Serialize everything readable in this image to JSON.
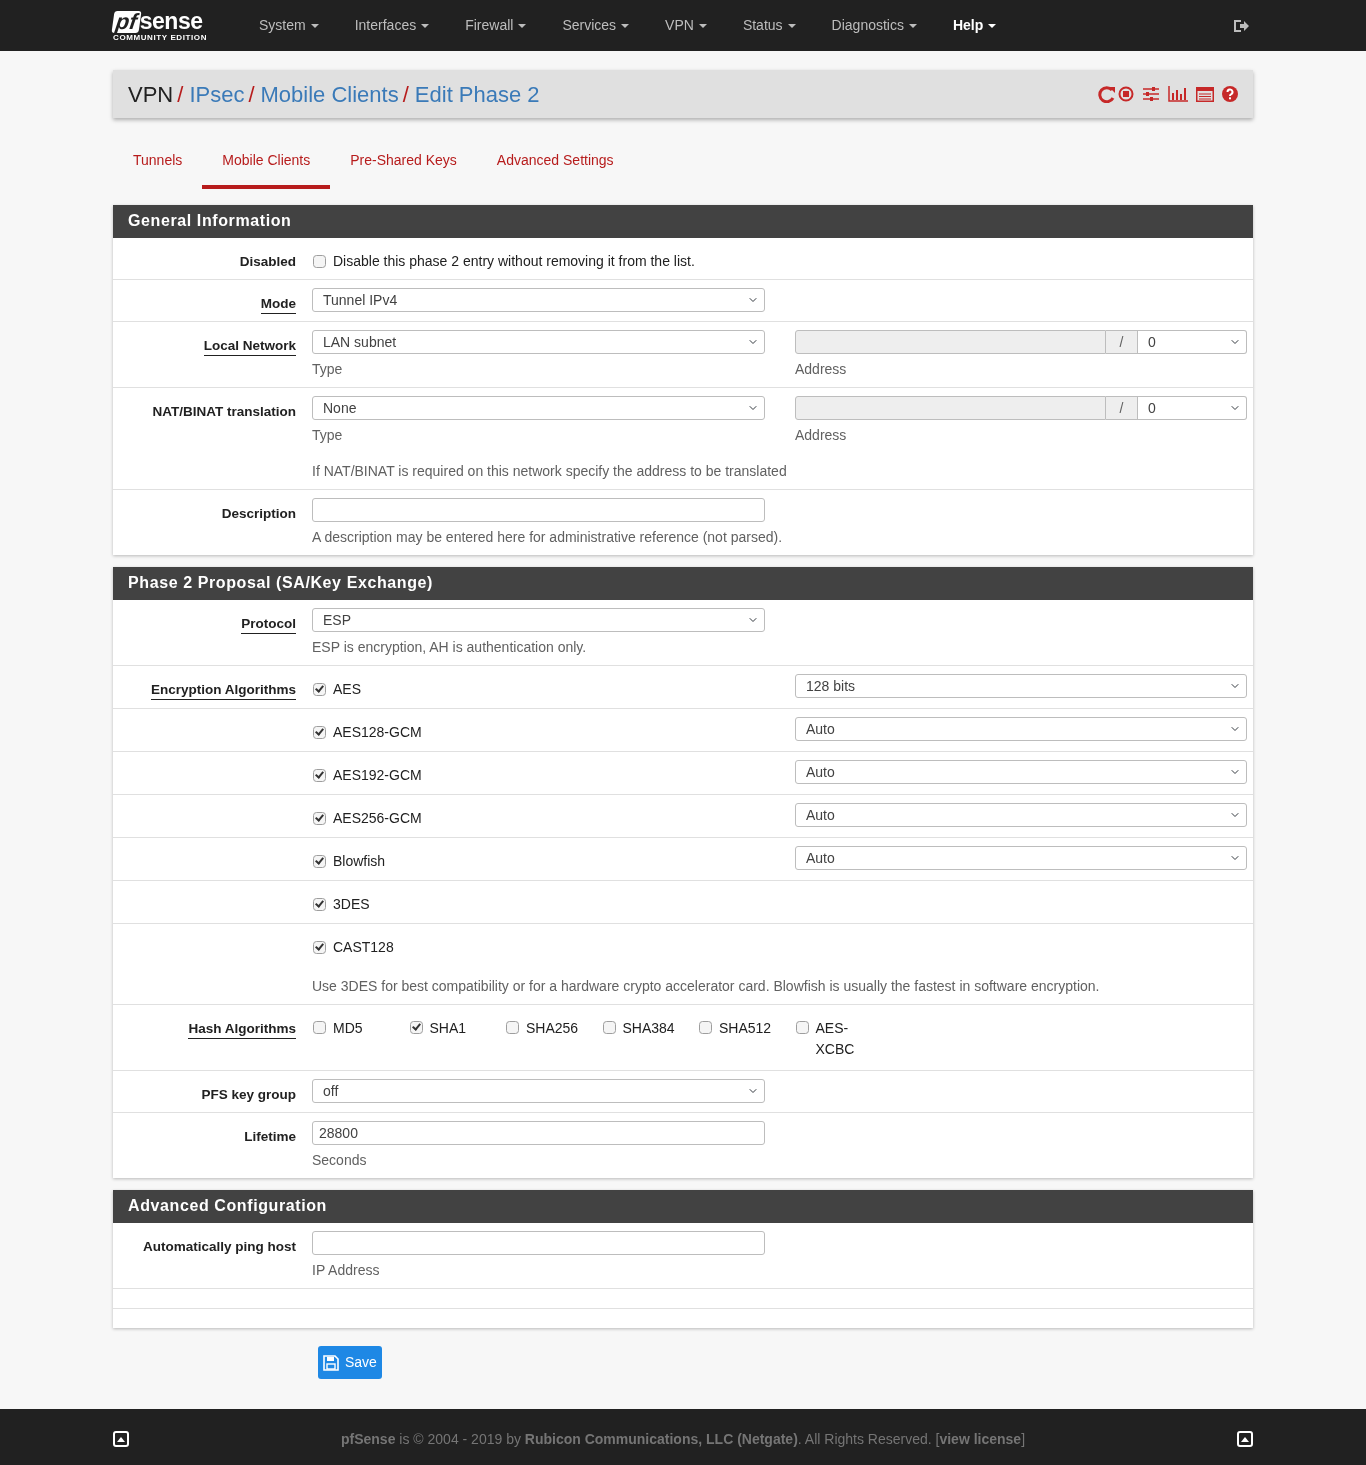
{
  "navbar": {
    "logo_mark": "pf",
    "logo_name": "sense",
    "logo_edition": "COMMUNITY EDITION",
    "menus": [
      {
        "label": "System",
        "selected": false
      },
      {
        "label": "Interfaces",
        "selected": false
      },
      {
        "label": "Firewall",
        "selected": false
      },
      {
        "label": "Services",
        "selected": false
      },
      {
        "label": "VPN",
        "selected": false
      },
      {
        "label": "Status",
        "selected": false
      },
      {
        "label": "Diagnostics",
        "selected": false
      },
      {
        "label": "Help",
        "selected": true
      }
    ]
  },
  "breadcrumb": [
    {
      "label": "VPN",
      "link": false
    },
    {
      "separator": "/",
      "label": "IPsec",
      "link": true
    },
    {
      "separator": "/",
      "label": "Mobile Clients",
      "link": true
    },
    {
      "separator": "/",
      "label": "Edit Phase 2",
      "link": true
    }
  ],
  "tabs": [
    {
      "label": "Tunnels",
      "selected": false
    },
    {
      "label": "Mobile Clients",
      "selected": true
    },
    {
      "label": "Pre-Shared Keys",
      "selected": false
    },
    {
      "label": "Advanced Settings",
      "selected": false
    }
  ],
  "sections": [
    {
      "title": "General Information",
      "rows": [
        {
          "kind": "checkbox",
          "label": "Disabled",
          "info_link": false,
          "checked": false,
          "text": "Disable this phase 2 entry without removing it from the list."
        },
        {
          "kind": "select",
          "label": "Mode",
          "info_link": true,
          "value": "Tunnel IPv4"
        },
        {
          "kind": "network",
          "label": "Local Network",
          "info_link": true,
          "type_value": "LAN subnet",
          "type_help": "Type",
          "slash": "/",
          "mask": "0",
          "address_help": "Address"
        },
        {
          "kind": "network",
          "label": "NAT/BINAT translation",
          "info_link": false,
          "type_value": "None",
          "type_help": "Type",
          "slash": "/",
          "mask": "0",
          "address_help": "Address",
          "help": "If NAT/BINAT is required on this network specify the address to be translated"
        },
        {
          "kind": "text",
          "label": "Description",
          "info_link": false,
          "help": "A description may be entered here for administrative reference (not parsed)."
        }
      ]
    },
    {
      "title": "Phase 2 Proposal (SA/Key Exchange)",
      "rows": [
        {
          "kind": "select",
          "label": "Protocol",
          "info_link": true,
          "value": "ESP",
          "help": "ESP is encryption, AH is authentication only."
        },
        {
          "kind": "encryption",
          "label": "Encryption Algorithms",
          "info_link": true,
          "items": [
            {
              "name": "AES",
              "checked": true,
              "key_length": "128 bits"
            },
            {
              "name": "AES128-GCM",
              "checked": true,
              "key_length": "Auto"
            },
            {
              "name": "AES192-GCM",
              "checked": true,
              "key_length": "Auto"
            },
            {
              "name": "AES256-GCM",
              "checked": true,
              "key_length": "Auto"
            },
            {
              "name": "Blowfish",
              "checked": true,
              "key_length": "Auto"
            },
            {
              "name": "3DES",
              "checked": true
            },
            {
              "name": "CAST128",
              "checked": true
            }
          ],
          "help": "Use 3DES for best compatibility or for a hardware crypto accelerator card. Blowfish is usually the fastest in software encryption."
        },
        {
          "kind": "hash",
          "label": "Hash Algorithms",
          "info_link": true,
          "items": [
            {
              "name": "MD5",
              "checked": false
            },
            {
              "name": "SHA1",
              "checked": true
            },
            {
              "name": "SHA256",
              "checked": false
            },
            {
              "name": "SHA384",
              "checked": false
            },
            {
              "name": "SHA512",
              "checked": false
            },
            {
              "name": "AES-XCBC",
              "checked": false
            }
          ]
        },
        {
          "kind": "select",
          "label": "PFS key group",
          "info_link": false,
          "value": "off"
        },
        {
          "kind": "text",
          "label": "Lifetime",
          "info_link": false,
          "value": "28800",
          "help": "Seconds"
        }
      ]
    },
    {
      "title": "Advanced Configuration",
      "rows": [
        {
          "kind": "text",
          "label": "Automatically ping host",
          "info_link": false,
          "help": "IP Address"
        }
      ]
    }
  ],
  "save_button": "Save",
  "footer": "**pfSense** is © 2004 - 2019 by **Rubicon Communications, LLC (Netgate)**. All Rights Reserved. [**view license**]"
}
